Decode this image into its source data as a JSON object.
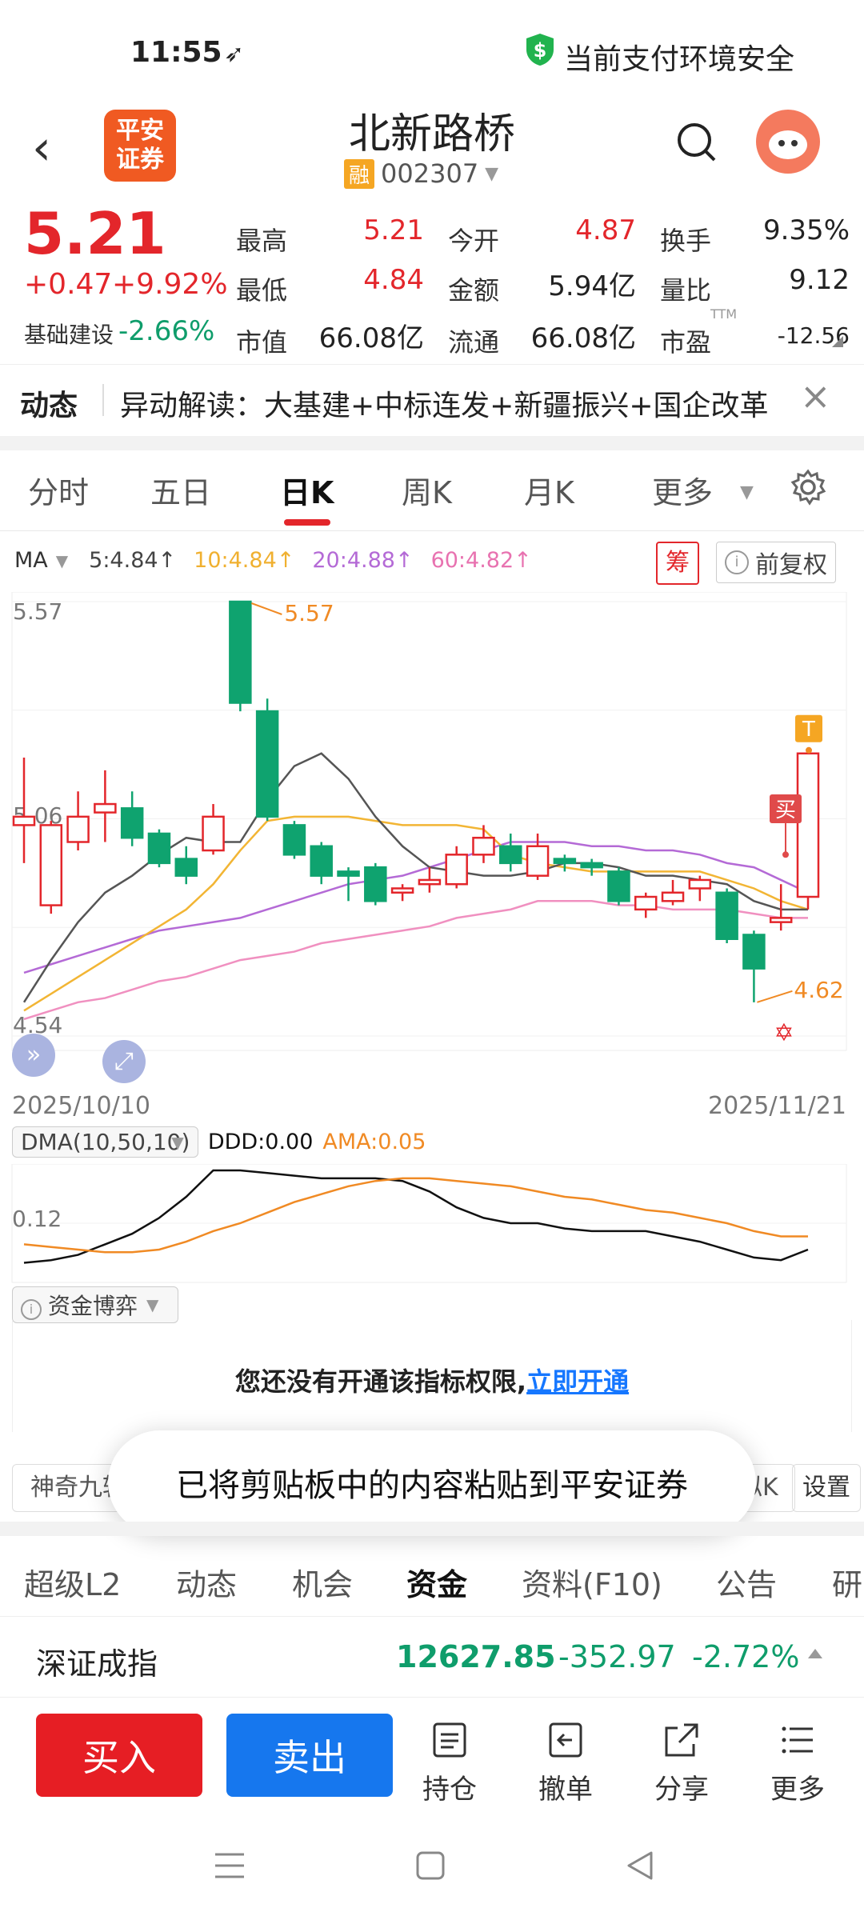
{
  "status_bar": {
    "time": "11:55",
    "security_text": "当前支付环境安全",
    "security_icon": "shield-dollar-icon"
  },
  "header": {
    "broker_logo_line1": "平安",
    "broker_logo_line2": "证券",
    "stock_name": "北新路桥",
    "margin_badge": "融",
    "stock_code": "002307"
  },
  "quote": {
    "price": "5.21",
    "change": "+0.47",
    "change_pct": "+9.92%",
    "sector_name": "基础建设",
    "sector_pct": "-2.66%",
    "fields": [
      {
        "label": "最高",
        "value": "5.21",
        "color": "red"
      },
      {
        "label": "今开",
        "value": "4.87",
        "color": "red"
      },
      {
        "label": "换手",
        "value": "9.35%",
        "color": "dark"
      },
      {
        "label": "最低",
        "value": "4.84",
        "color": "red"
      },
      {
        "label": "金额",
        "value": "5.94亿",
        "color": "dark"
      },
      {
        "label": "量比",
        "value": "9.12",
        "color": "dark"
      },
      {
        "label": "市值",
        "value": "66.08亿",
        "color": "dark"
      },
      {
        "label": "流通",
        "value": "66.08亿",
        "color": "dark"
      },
      {
        "label": "市盈",
        "value": "-12.56",
        "color": "dark"
      }
    ],
    "pe_superscript": "TTM"
  },
  "news": {
    "label": "动态",
    "text": "异动解读：大基建+中标连发+新疆振兴+国企改革"
  },
  "chart_tabs": {
    "items": [
      "分时",
      "五日",
      "日K",
      "周K",
      "月K",
      "更多"
    ],
    "active": "日K"
  },
  "ma_legend": {
    "label": "MA",
    "ma5": "5:4.84↑",
    "ma10": "10:4.84↑",
    "ma20": "20:4.88↑",
    "ma60": "60:4.82↑",
    "chip_btn": "筹",
    "restore_btn": "前复权"
  },
  "colors": {
    "up": "#e3262b",
    "down": "#0fa36f",
    "ma5": "#555555",
    "ma10": "#f2b534",
    "ma20": "#b46ad6",
    "ma60": "#f090c0",
    "accent": "#e3262b",
    "link": "#1677ff"
  },
  "chart_data": [
    {
      "type": "candlestick",
      "title": "",
      "ylim": [
        4.54,
        5.57
      ],
      "y_ticks": [
        "5.57",
        "5.06",
        "4.54"
      ],
      "x_start": "2025/10/10",
      "x_end": "2025/11/21",
      "high_annotation": "5.57",
      "low_annotation": "4.62",
      "buy_marker": "买",
      "t_marker": "T",
      "candles": [
        {
          "o": 5.04,
          "c": 5.06,
          "h": 5.2,
          "l": 4.95
        },
        {
          "o": 4.85,
          "c": 5.04,
          "h": 5.05,
          "l": 4.83
        },
        {
          "o": 5.0,
          "c": 5.06,
          "h": 5.12,
          "l": 4.98
        },
        {
          "o": 5.07,
          "c": 5.09,
          "h": 5.17,
          "l": 5.0
        },
        {
          "o": 5.08,
          "c": 5.01,
          "h": 5.12,
          "l": 4.99
        },
        {
          "o": 5.02,
          "c": 4.95,
          "h": 5.03,
          "l": 4.94
        },
        {
          "o": 4.96,
          "c": 4.92,
          "h": 4.99,
          "l": 4.9
        },
        {
          "o": 4.98,
          "c": 5.06,
          "h": 5.09,
          "l": 4.97
        },
        {
          "o": 5.57,
          "c": 5.33,
          "h": 5.57,
          "l": 5.31
        },
        {
          "o": 5.31,
          "c": 5.06,
          "h": 5.34,
          "l": 5.05
        },
        {
          "o": 5.04,
          "c": 4.97,
          "h": 5.05,
          "l": 4.96
        },
        {
          "o": 4.99,
          "c": 4.92,
          "h": 5.0,
          "l": 4.9
        },
        {
          "o": 4.93,
          "c": 4.92,
          "h": 4.94,
          "l": 4.86
        },
        {
          "o": 4.94,
          "c": 4.86,
          "h": 4.95,
          "l": 4.85
        },
        {
          "o": 4.88,
          "c": 4.89,
          "h": 4.9,
          "l": 4.86
        },
        {
          "o": 4.9,
          "c": 4.91,
          "h": 4.94,
          "l": 4.88
        },
        {
          "o": 4.9,
          "c": 4.97,
          "h": 4.99,
          "l": 4.89
        },
        {
          "o": 4.97,
          "c": 5.01,
          "h": 5.04,
          "l": 4.95
        },
        {
          "o": 4.99,
          "c": 4.95,
          "h": 5.02,
          "l": 4.93
        },
        {
          "o": 4.92,
          "c": 4.99,
          "h": 5.02,
          "l": 4.91
        },
        {
          "o": 4.96,
          "c": 4.95,
          "h": 4.97,
          "l": 4.93
        },
        {
          "o": 4.95,
          "c": 4.94,
          "h": 4.96,
          "l": 4.92
        },
        {
          "o": 4.93,
          "c": 4.86,
          "h": 4.94,
          "l": 4.85
        },
        {
          "o": 4.84,
          "c": 4.87,
          "h": 4.88,
          "l": 4.82
        },
        {
          "o": 4.86,
          "c": 4.88,
          "h": 4.91,
          "l": 4.85
        },
        {
          "o": 4.89,
          "c": 4.91,
          "h": 4.92,
          "l": 4.86
        },
        {
          "o": 4.88,
          "c": 4.77,
          "h": 4.89,
          "l": 4.76
        },
        {
          "o": 4.78,
          "c": 4.7,
          "h": 4.79,
          "l": 4.62
        },
        {
          "o": 4.81,
          "c": 4.82,
          "h": 4.9,
          "l": 4.79
        },
        {
          "o": 4.87,
          "c": 5.21,
          "h": 5.21,
          "l": 4.84
        }
      ],
      "ma5": [
        4.62,
        4.72,
        4.81,
        4.88,
        4.92,
        4.97,
        5.01,
        5.0,
        5.0,
        5.1,
        5.18,
        5.21,
        5.15,
        5.06,
        4.99,
        4.94,
        4.93,
        4.92,
        4.92,
        4.93,
        4.95,
        4.95,
        4.94,
        4.92,
        4.92,
        4.91,
        4.9,
        4.86,
        4.84,
        4.84
      ],
      "ma10": [
        4.6,
        4.64,
        4.68,
        4.72,
        4.76,
        4.8,
        4.84,
        4.9,
        4.98,
        5.05,
        5.06,
        5.06,
        5.06,
        5.05,
        5.04,
        5.04,
        5.04,
        5.03,
        4.97,
        4.95,
        4.94,
        4.93,
        4.93,
        4.93,
        4.93,
        4.93,
        4.91,
        4.89,
        4.86,
        4.84
      ],
      "ma20": [
        4.69,
        4.71,
        4.73,
        4.75,
        4.77,
        4.79,
        4.8,
        4.81,
        4.82,
        4.84,
        4.86,
        4.88,
        4.9,
        4.91,
        4.92,
        4.94,
        4.96,
        4.98,
        5.0,
        5.0,
        5.0,
        4.99,
        4.99,
        4.98,
        4.98,
        4.97,
        4.95,
        4.94,
        4.91,
        4.88
      ],
      "ma60": [
        4.58,
        4.6,
        4.62,
        4.63,
        4.65,
        4.67,
        4.68,
        4.7,
        4.72,
        4.73,
        4.74,
        4.76,
        4.77,
        4.78,
        4.79,
        4.8,
        4.82,
        4.83,
        4.84,
        4.86,
        4.86,
        4.86,
        4.85,
        4.85,
        4.84,
        4.84,
        4.84,
        4.83,
        4.82,
        4.82
      ]
    },
    {
      "type": "line",
      "title": "DMA(10,50,10)",
      "legend": [
        "DDD:0.00",
        "AMA:0.05"
      ],
      "y_tick": "0.12",
      "ylim": [
        -0.1,
        0.3
      ],
      "series": [
        {
          "name": "DDD",
          "values": [
            -0.05,
            -0.04,
            -0.02,
            0.02,
            0.06,
            0.12,
            0.2,
            0.3,
            0.3,
            0.29,
            0.28,
            0.27,
            0.27,
            0.27,
            0.26,
            0.22,
            0.16,
            0.12,
            0.1,
            0.1,
            0.08,
            0.07,
            0.07,
            0.07,
            0.05,
            0.03,
            0.0,
            -0.03,
            -0.04,
            0.0
          ]
        },
        {
          "name": "AMA",
          "values": [
            0.02,
            0.01,
            0.0,
            -0.01,
            -0.01,
            0.0,
            0.03,
            0.07,
            0.1,
            0.14,
            0.18,
            0.21,
            0.24,
            0.26,
            0.27,
            0.27,
            0.26,
            0.25,
            0.24,
            0.22,
            0.2,
            0.19,
            0.17,
            0.15,
            0.14,
            0.12,
            0.1,
            0.07,
            0.05,
            0.05
          ]
        }
      ]
    }
  ],
  "capital_panel": {
    "title": "资金博弈",
    "locked_text": "您还没有开通该指标权限,",
    "link_text": "立即开通"
  },
  "indicator_bar": {
    "left_text": "神奇九转",
    "right_text": "相似K",
    "settings": "设置"
  },
  "toast": {
    "text": "已将剪贴板中的内容粘贴到平安证券"
  },
  "sub_tabs": {
    "items": [
      "超级L2",
      "动态",
      "机会",
      "资金",
      "资料(F10)",
      "公告",
      "研"
    ],
    "active": "资金"
  },
  "index": {
    "name": "深证成指",
    "value": "12627.85",
    "change": "-352.97",
    "pct": "-2.72%"
  },
  "bottom_bar": {
    "buy": "买入",
    "sell": "卖出",
    "tools": [
      {
        "label": "持仓",
        "icon": "position-icon"
      },
      {
        "label": "撤单",
        "icon": "withdraw-icon"
      },
      {
        "label": "分享",
        "icon": "share-icon"
      },
      {
        "label": "更多",
        "icon": "more-icon"
      }
    ]
  }
}
